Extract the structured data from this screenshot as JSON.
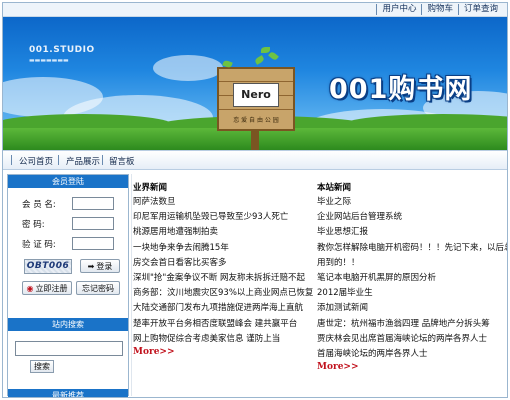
{
  "top_links": [
    "用户中心",
    "购物车",
    "订单查询"
  ],
  "banner": {
    "studio": "001.STUDIO",
    "site_title": "001购书网",
    "sign_logo": "Nero",
    "sign_tagline": "恋 爱 自 由 公 园"
  },
  "nav": [
    "公司首页",
    "产品展示",
    "留言板"
  ],
  "sidebar": {
    "login_title": "会员登陆",
    "fields": [
      {
        "label": "会 员 名:",
        "value": ""
      },
      {
        "label": "密     码:",
        "value": ""
      },
      {
        "label": "验 证 码:",
        "value": ""
      }
    ],
    "captcha": "OBT006",
    "login_button": "登录",
    "register_button": "立即注册",
    "forgot_button": "忘记密码",
    "search_title": "站内搜索",
    "search_button": "搜索",
    "bottom_title": "最新推荐"
  },
  "industry_news": {
    "title": "业界新闻",
    "items": [
      "阿萨法数旦",
      "印尼军用运输机坠毁已导致至少93人死亡",
      "桃源居用地遭强制拍卖",
      "一块地争来争去闹腾15年",
      "房交会首日看客比买客多",
      "深圳\"抢\"金案争议不断 网友称未拆拆迁赔不起",
      "商务部：汶川地震灾区93%以上商业网点已恢复",
      "大陆交通部门发布九项措施促进两岸海上直航",
      "楚率开放平台务相否度联盟峰会 建共赢平台",
      "网上购物促综合考虑美家信息 谨防上当"
    ],
    "more": "More>>"
  },
  "site_news": {
    "title": "本站新闻",
    "items": [
      "毕业之际",
      "企业网站后台管理系统",
      "毕业思想汇报",
      "教你怎样解除电脑开机密码！！！先记下来，以后总会有",
      "用到的！！",
      "笔记本电脑开机黑屏的原因分析",
      "2012届毕业生",
      "添加测试新闻",
      "唐世定：杭州福市渔翁四理 品牌地产分拆头筹",
      "贾庆林会见出席首届海峡论坛的两岸各界人士",
      "首届海峡论坛的两岸各界人士"
    ],
    "more": "More>>"
  },
  "colors": {
    "banner_top": "#0c67c9",
    "sidebar_header": "#1a73c8",
    "more_link": "#c1121d"
  }
}
